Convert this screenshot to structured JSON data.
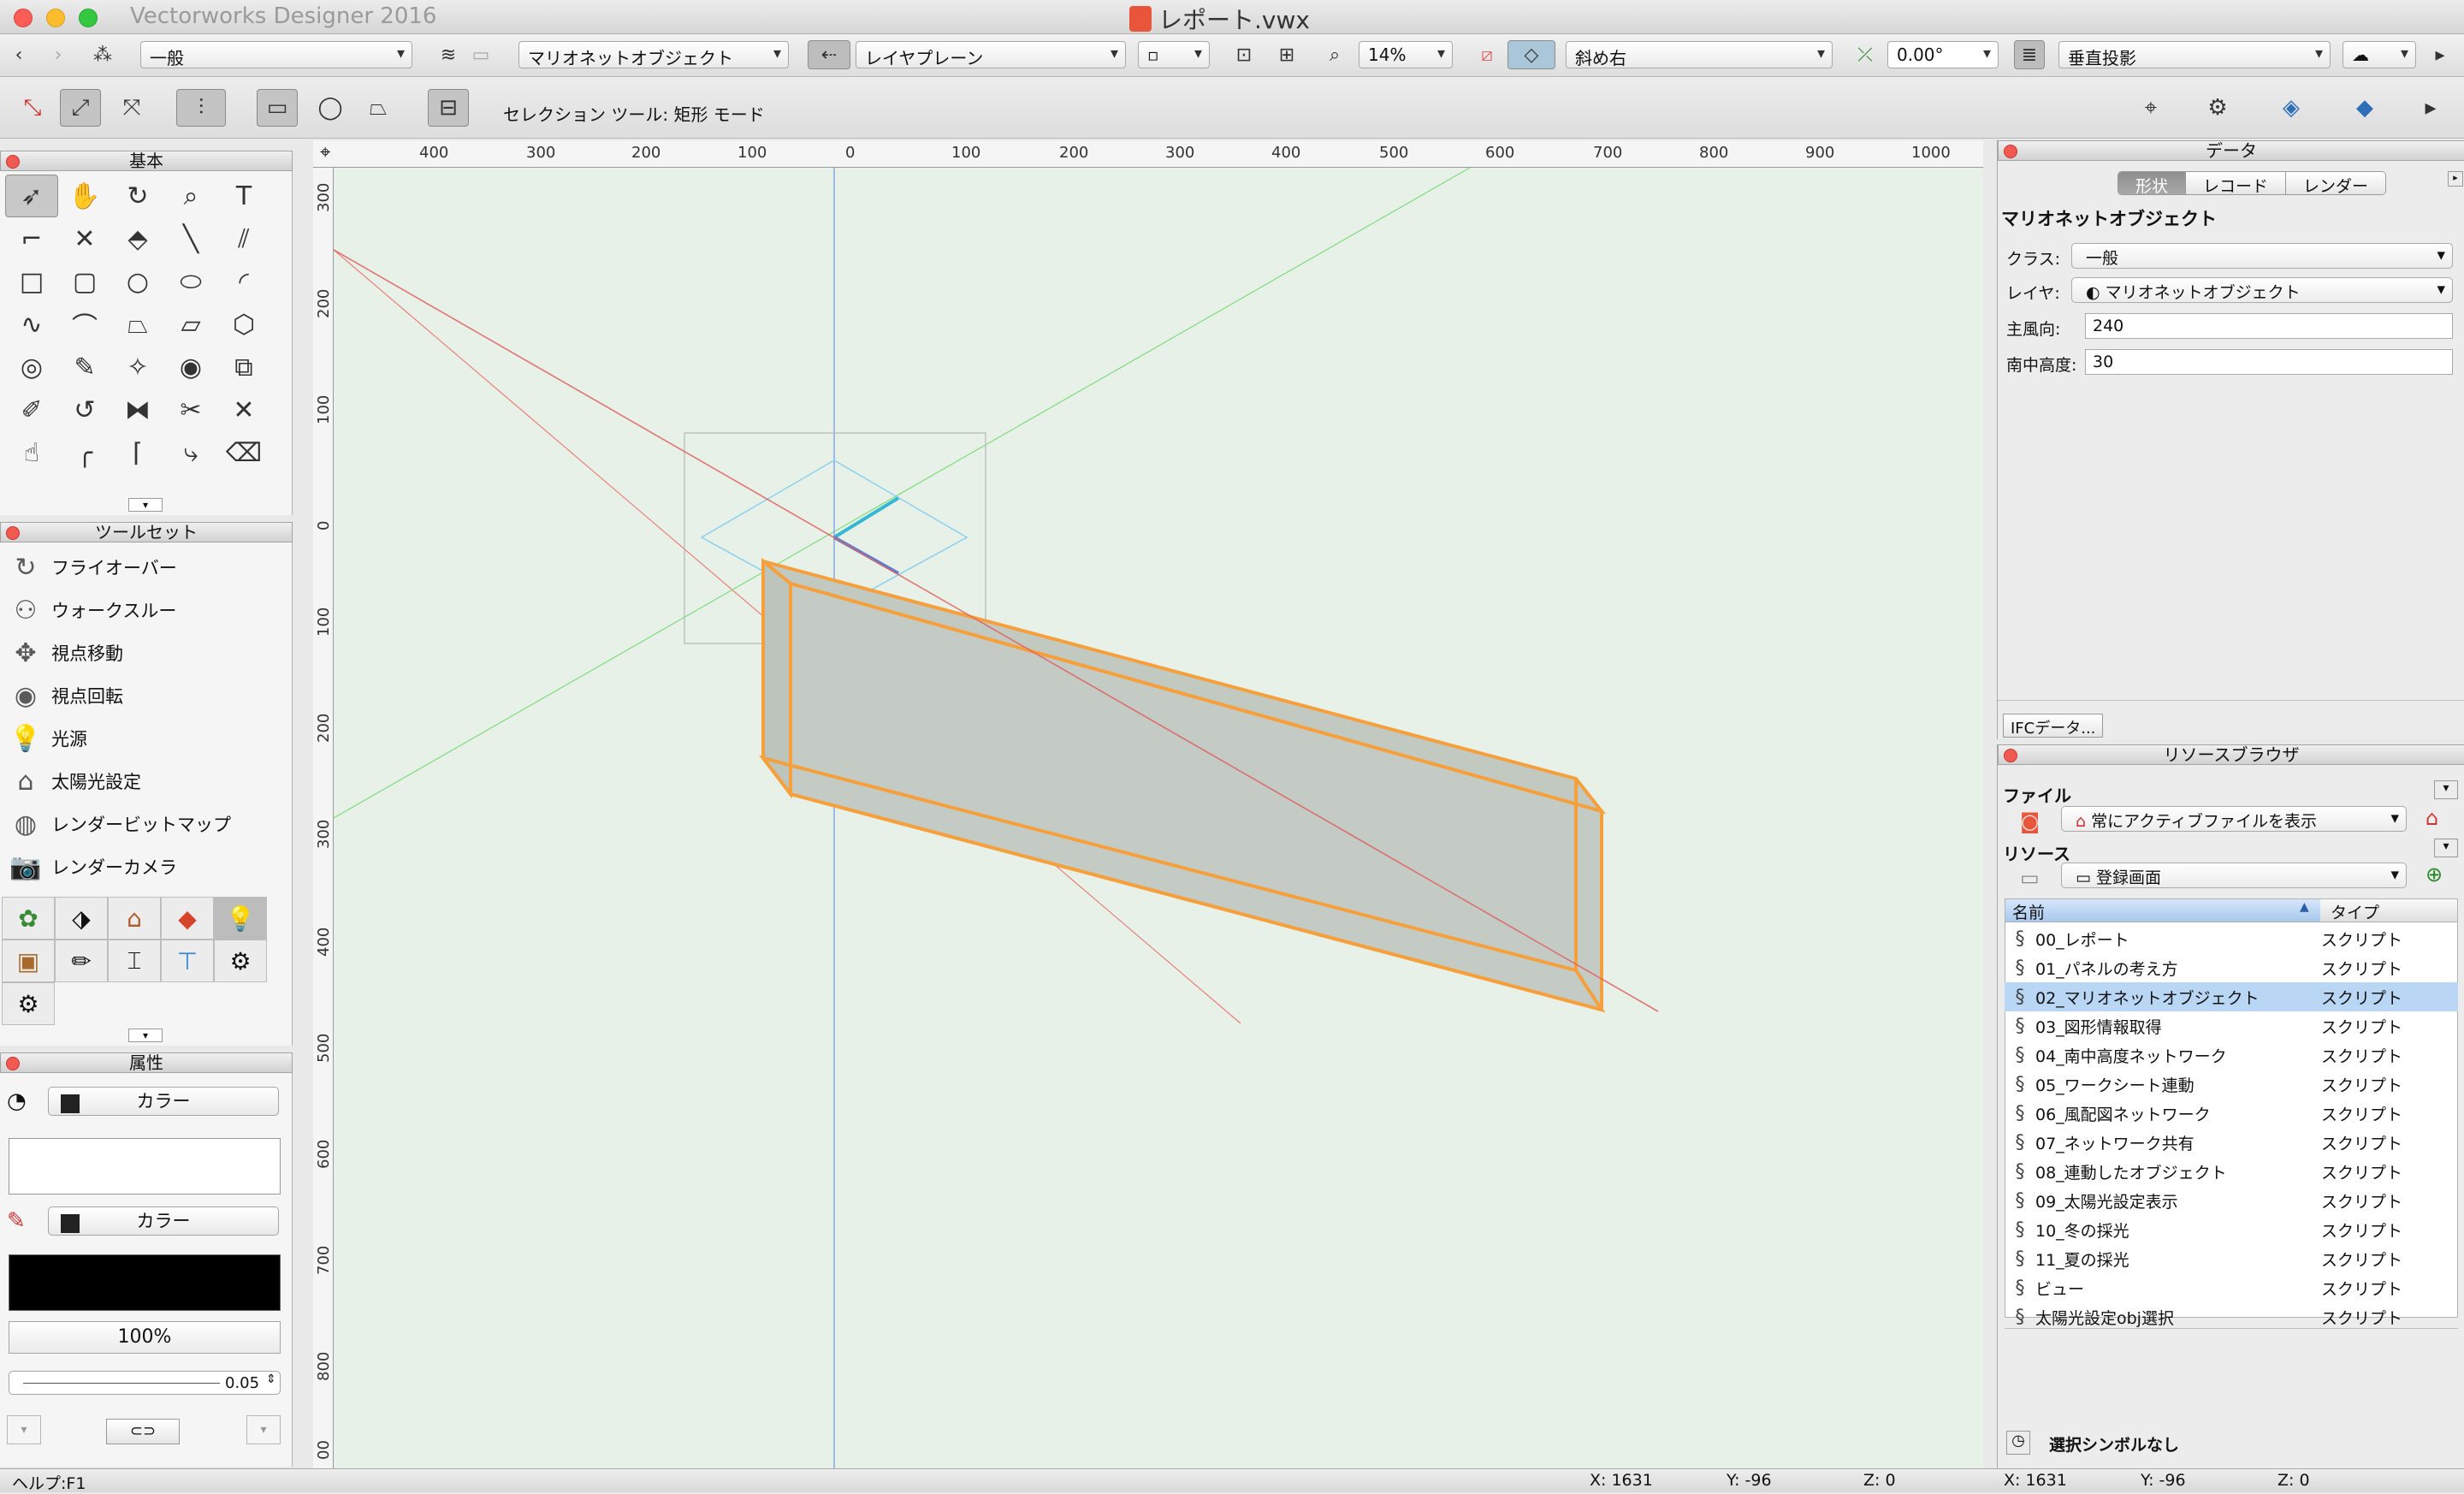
{
  "window": {
    "app_title": "Vectorworks Designer 2016",
    "doc_title": "レポート.vwx"
  },
  "viewbar": {
    "class_value": "一般",
    "layer_value": "マリオネットオブジェクト",
    "plane_value": "レイヤプレーン",
    "zoom_value": "14%",
    "view_value": "斜め右",
    "angle_value": "0.00°",
    "projection_value": "垂直投影"
  },
  "modebar": {
    "mode_text": "セレクション ツール: 矩形 モード"
  },
  "basic_palette": {
    "title": "基本",
    "text_tool_label": "T"
  },
  "toolset_palette": {
    "title": "ツールセット",
    "items": [
      "フライオーバー",
      "ウォークスルー",
      "視点移動",
      "視点回転",
      "光源",
      "太陽光設定",
      "レンダービットマップ",
      "レンダーカメラ"
    ]
  },
  "attributes_palette": {
    "title": "属性",
    "fill_mode": "カラー",
    "pen_mode": "カラー",
    "opacity": "100%",
    "line_weight": "0.05"
  },
  "rulers": {
    "h_labels": [
      "400",
      "300",
      "200",
      "100",
      "0",
      "100",
      "200",
      "300",
      "400",
      "500",
      "600",
      "700",
      "800",
      "900",
      "1000"
    ],
    "v_labels": [
      "300",
      "200",
      "100",
      "0",
      "100",
      "200",
      "300",
      "400",
      "500",
      "600",
      "700",
      "800",
      "00"
    ]
  },
  "data_palette": {
    "title": "データ",
    "tabs": [
      "形状",
      "レコード",
      "レンダー"
    ],
    "object_type": "マリオネットオブジェクト",
    "class_label": "クラス:",
    "class_value": "一般",
    "layer_label": "レイヤ:",
    "layer_value": "マリオネットオブジェクト",
    "main_dir_label": "主風向:",
    "main_dir_value": "240",
    "sun_alt_label": "南中高度:",
    "sun_alt_value": "30",
    "ifc_button": "IFCデータ..."
  },
  "resource_browser": {
    "title": "リソースブラウザ",
    "file_label": "ファイル",
    "file_value": "常にアクティブファイルを表示",
    "resource_label": "リソース",
    "resource_value": "登録画面",
    "col_name": "名前",
    "col_type": "タイプ",
    "rows": [
      {
        "name": "00_レポート",
        "type": "スクリプト"
      },
      {
        "name": "01_パネルの考え方",
        "type": "スクリプト"
      },
      {
        "name": "02_マリオネットオブジェクト",
        "type": "スクリプト"
      },
      {
        "name": "03_図形情報取得",
        "type": "スクリプト"
      },
      {
        "name": "04_南中高度ネットワーク",
        "type": "スクリプト"
      },
      {
        "name": "05_ワークシート連動",
        "type": "スクリプト"
      },
      {
        "name": "06_風配図ネットワーク",
        "type": "スクリプト"
      },
      {
        "name": "07_ネットワーク共有",
        "type": "スクリプト"
      },
      {
        "name": "08_連動したオブジェクト",
        "type": "スクリプト"
      },
      {
        "name": "09_太陽光設定表示",
        "type": "スクリプト"
      },
      {
        "name": "10_冬の採光",
        "type": "スクリプト"
      },
      {
        "name": "11_夏の採光",
        "type": "スクリプト"
      },
      {
        "name": "ビュー",
        "type": "スクリプト"
      },
      {
        "name": "太陽光設定obj選択",
        "type": "スクリプト"
      }
    ],
    "selected_row": 2,
    "footer": "選択シンボルなし"
  },
  "statusbar": {
    "help": "ヘルプ:F1",
    "x1": "X:  1631",
    "y1": "Y:  -96",
    "z1": "Z:  0",
    "x2": "X:  1631",
    "y2": "Y:  -96",
    "z2": "Z:  0"
  },
  "colors": {
    "selection_orange": "#f5a03c",
    "object_fill": "#c4cbc4",
    "canvas_bg": "#e8f1e8",
    "row_highlight": "#b9d6f5"
  }
}
